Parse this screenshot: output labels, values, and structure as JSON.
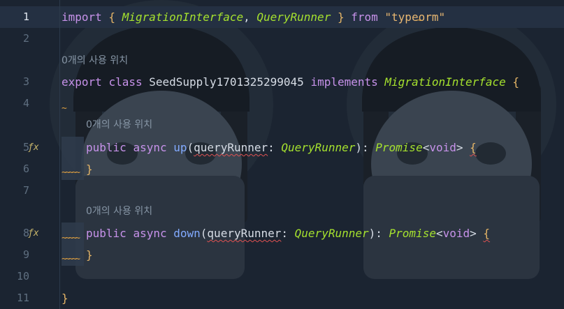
{
  "editor": {
    "lines": [
      {
        "number": "1",
        "tokens": [
          {
            "t": "import",
            "c": "kw"
          },
          {
            "t": " { ",
            "c": "brace"
          },
          {
            "t": "MigrationInterface",
            "c": "typ"
          },
          {
            "t": ", ",
            "c": "punc"
          },
          {
            "t": "QueryRunner",
            "c": "typ"
          },
          {
            "t": " } ",
            "c": "brace"
          },
          {
            "t": "from",
            "c": "kw"
          },
          {
            "t": " ",
            "c": "punc"
          },
          {
            "t": "\"typeorm\"",
            "c": "str"
          }
        ]
      },
      {
        "number": "2",
        "tokens": []
      },
      {
        "number": "3",
        "hint": "0개의 사용 위치",
        "tokens": [
          {
            "t": "export",
            "c": "kw"
          },
          {
            "t": " ",
            "c": "punc"
          },
          {
            "t": "class",
            "c": "kw"
          },
          {
            "t": " SeedSupply1701325299045 ",
            "c": "punc"
          },
          {
            "t": "implements",
            "c": "kw"
          },
          {
            "t": " ",
            "c": "punc"
          },
          {
            "t": "MigrationInterface",
            "c": "typ"
          },
          {
            "t": " {",
            "c": "brace"
          }
        ]
      },
      {
        "number": "4",
        "tokens": []
      },
      {
        "number": "5",
        "hint": "0개의 사용 위치",
        "tokens": [
          {
            "t": "public",
            "c": "kw"
          },
          {
            "t": " ",
            "c": "punc"
          },
          {
            "t": "async",
            "c": "kw"
          },
          {
            "t": " ",
            "c": "punc"
          },
          {
            "t": "up",
            "c": "fn"
          },
          {
            "t": "(",
            "c": "punc"
          },
          {
            "t": "queryRunner",
            "c": "punc sq"
          },
          {
            "t": ": ",
            "c": "punc"
          },
          {
            "t": "QueryRunner",
            "c": "typ"
          },
          {
            "t": "): ",
            "c": "punc"
          },
          {
            "t": "Promise",
            "c": "typ"
          },
          {
            "t": "<",
            "c": "punc"
          },
          {
            "t": "void",
            "c": "kw"
          },
          {
            "t": "> ",
            "c": "punc"
          },
          {
            "t": "{",
            "c": "brace sq"
          }
        ]
      },
      {
        "number": "6",
        "tokens": [
          {
            "t": "}",
            "c": "brace"
          }
        ]
      },
      {
        "number": "7",
        "tokens": []
      },
      {
        "number": "8",
        "hint": "0개의 사용 위치",
        "tokens": [
          {
            "t": "public",
            "c": "kw"
          },
          {
            "t": " ",
            "c": "punc"
          },
          {
            "t": "async",
            "c": "kw"
          },
          {
            "t": " ",
            "c": "punc"
          },
          {
            "t": "down",
            "c": "fn"
          },
          {
            "t": "(",
            "c": "punc"
          },
          {
            "t": "queryRunner",
            "c": "punc sq"
          },
          {
            "t": ": ",
            "c": "punc"
          },
          {
            "t": "QueryRunner",
            "c": "typ"
          },
          {
            "t": "): ",
            "c": "punc"
          },
          {
            "t": "Promise",
            "c": "typ"
          },
          {
            "t": "<",
            "c": "punc"
          },
          {
            "t": "void",
            "c": "kw"
          },
          {
            "t": "> ",
            "c": "punc"
          },
          {
            "t": "{",
            "c": "brace sq"
          }
        ]
      },
      {
        "number": "9",
        "tokens": [
          {
            "t": "}",
            "c": "brace"
          }
        ]
      },
      {
        "number": "10",
        "tokens": []
      },
      {
        "number": "11",
        "tokens": [
          {
            "t": "}",
            "c": "brace"
          }
        ]
      }
    ],
    "gutter_icon": "ƒx"
  }
}
